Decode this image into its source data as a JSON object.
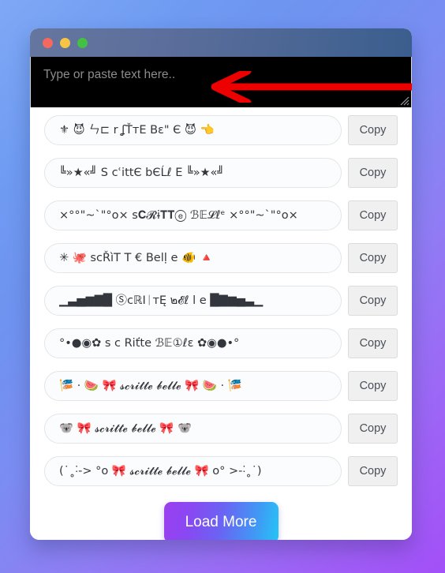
{
  "window": {
    "traffic_lights": [
      "close",
      "minimize",
      "maximize"
    ],
    "colors": {
      "close": "#f4695f",
      "minimize": "#f6c544",
      "maximize": "#42c143",
      "titlebar_left": "#65769f",
      "titlebar_right": "#3a5e8e",
      "page_background_start": "#7fa9f5",
      "page_background_end": "#a24ff7",
      "annotation_arrow": "#ec0000",
      "load_more_gradient_start": "#9b3ff0",
      "load_more_gradient_end": "#23c6f7"
    }
  },
  "input": {
    "placeholder": "Type or paste text here..",
    "value": ""
  },
  "results": [
    {
      "text": "⚜ 😈 ㄣ⊏ r ʆŤтE Bɛ\" Є 😈 👈",
      "copy_label": "Copy"
    },
    {
      "text": "╚»★«╝ S cʿittЄ bЄĹℓ E ╚»★«╝",
      "copy_label": "Copy"
    },
    {
      "text": "×°°\"~`\"°o× ѕ𝐂𝓡ɨ𝐓𝐓ⓔ ℬ𝔼𝓛ℓᵉ ×°°\"~`\"°o×",
      "copy_label": "Copy"
    },
    {
      "text": "✳ 🐙 scŘìT T € Belḷ e 🐠 🔺",
      "copy_label": "Copy"
    },
    {
      "text": "▁▃▅▆▇█ ⓈcℝIᛁтĘ ๒𝓔ℓ l e █▇▆▅▃▁",
      "copy_label": "Copy"
    },
    {
      "text": "°•●◉✿ ѕ c Riťte ℬ𝔼①ℓε ✿◉●•°",
      "copy_label": "Copy"
    },
    {
      "text": "🎏 · 🍉 🎀 𝓼𝓬𝓻𝓲𝓽𝓽𝓮 𝓫𝓮𝓵𝓵𝓮 🎀 🍉 · 🎏",
      "copy_label": "Copy"
    },
    {
      "text": "🐨 🎀 𝓼𝓬𝓻𝓲𝓽𝓽𝓮 𝓫𝓮𝓵𝓵𝓮 🎀 🐨",
      "copy_label": "Copy"
    },
    {
      "text": "(˙˳˸-> °o 🎀 𝓼𝓬𝓻𝓲𝓽𝓽𝓮 𝓫𝓮𝓵𝓵𝓮 🎀 o° >-˸˳˙)",
      "copy_label": "Copy"
    }
  ],
  "load_more": {
    "label": "Load More"
  }
}
